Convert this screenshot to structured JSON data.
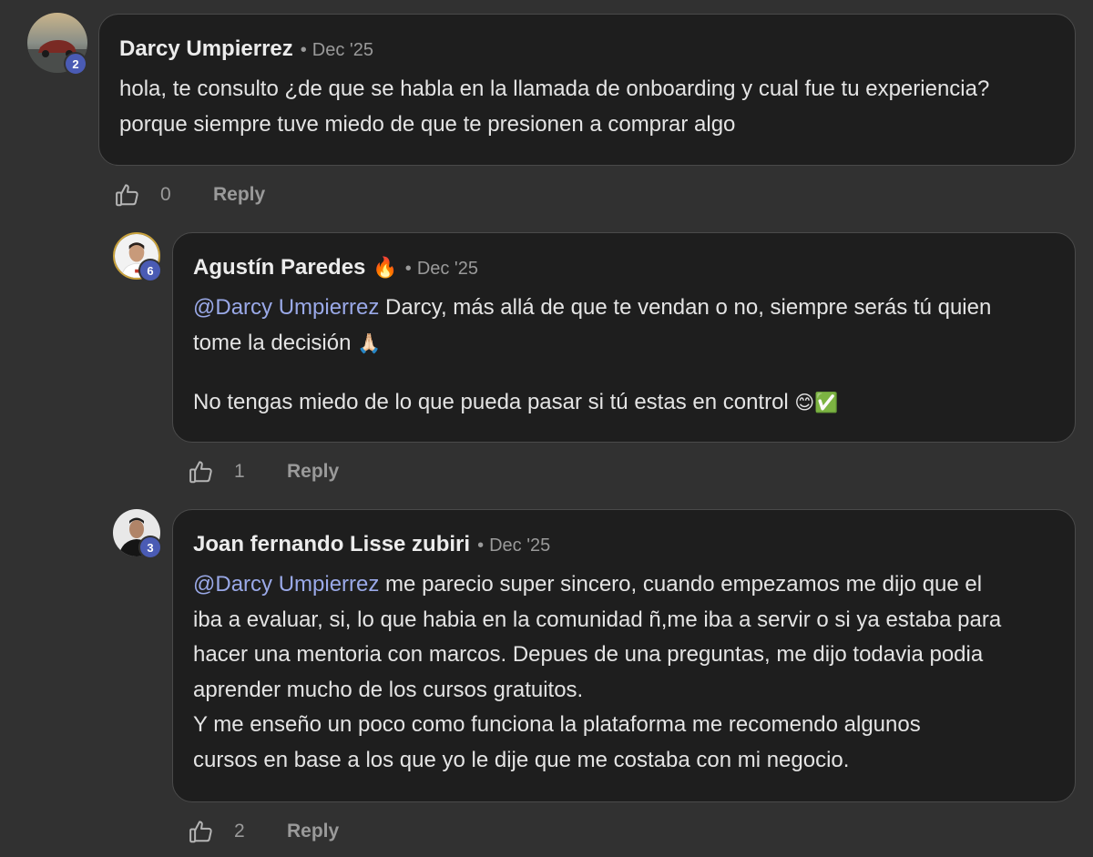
{
  "comments": [
    {
      "author": "Darcy Umpierrez",
      "separator": "•",
      "date": "Dec '25",
      "level": "2",
      "paragraphs": [
        [
          "hola, te consulto ¿de que se habla en la llamada de onboarding y cual fue tu experiencia?",
          "porque siempre tuve miedo de que te presionen a comprar algo"
        ]
      ],
      "likes": "0",
      "reply_label": "Reply"
    },
    {
      "author": "Agustín Paredes",
      "author_emoji": "🔥",
      "separator": "•",
      "date": "Dec '25",
      "level": "6",
      "mention": "@Darcy Umpierrez",
      "line1_rest": " Darcy, más allá de que te vendan o no, siempre serás tú quien",
      "line2": "tome la decisión ",
      "line2_emoji": "🙏🏻",
      "line3": "No tengas miedo de lo que pueda pasar si tú estas en control ",
      "line3_emoji": "😊✅",
      "likes": "1",
      "reply_label": "Reply"
    },
    {
      "author": "Joan fernando Lisse zubiri",
      "separator": "•",
      "date": "Dec '25",
      "level": "3",
      "mention": "@Darcy Umpierrez",
      "line1_rest": " me parecio super sincero, cuando empezamos me dijo que el",
      "lines": [
        "iba a evaluar, si, lo que habia en la comunidad ñ,me iba a servir o si ya estaba para",
        "hacer una mentoria con marcos. Depues de una preguntas, me dijo todavia podia",
        "aprender mucho de los cursos gratuitos.",
        "Y me enseño un poco como funciona la plataforma me recomendo algunos",
        "cursos en base a los que yo le dije que me costaba con mi negocio."
      ],
      "likes": "2",
      "reply_label": "Reply"
    }
  ],
  "icons": {
    "like": "thumbs-up-icon"
  },
  "colors": {
    "background": "#313131",
    "bubble": "#1e1e1e",
    "bubble_border": "#4a4a4a",
    "mention": "#9aa9e8",
    "badge": "#4a5bb4",
    "muted": "#9a9a9a"
  }
}
